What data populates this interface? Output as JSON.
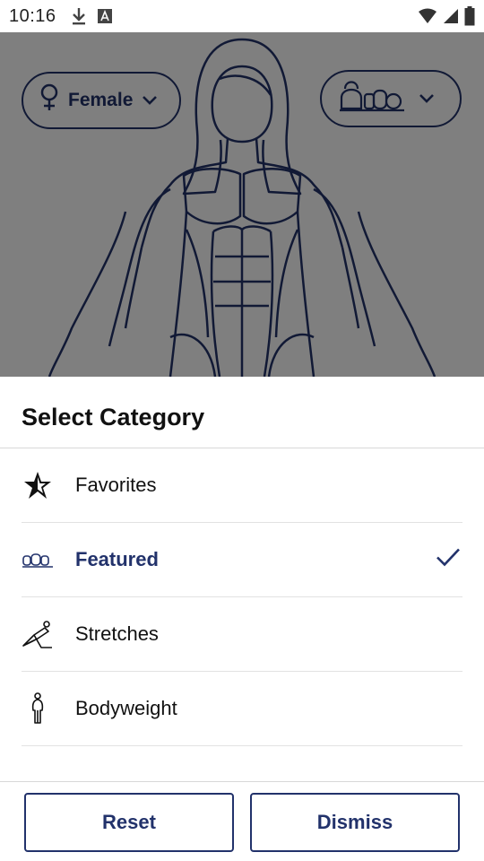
{
  "status_bar": {
    "time": "10:16",
    "icons_left": [
      "download-icon",
      "font-a-icon"
    ],
    "icons_right": [
      "wifi-icon",
      "signal-icon",
      "battery-icon"
    ]
  },
  "background": {
    "gender_selector": {
      "label": "Female",
      "icon": "female-symbol-icon"
    },
    "equipment_selector": {
      "icon": "kettlebell-dumbbell-icon"
    }
  },
  "sheet": {
    "title": "Select Category",
    "categories": [
      {
        "label": "Favorites",
        "icon": "star-icon",
        "selected": false
      },
      {
        "label": "Featured",
        "icon": "dumbbells-icon",
        "selected": true
      },
      {
        "label": "Stretches",
        "icon": "stretching-figure-icon",
        "selected": false
      },
      {
        "label": "Bodyweight",
        "icon": "standing-figure-icon",
        "selected": false
      }
    ],
    "reset_label": "Reset",
    "dismiss_label": "Dismiss"
  },
  "colors": {
    "accent": "#22326b",
    "scrim": "rgba(0,0,0,0.5)"
  }
}
